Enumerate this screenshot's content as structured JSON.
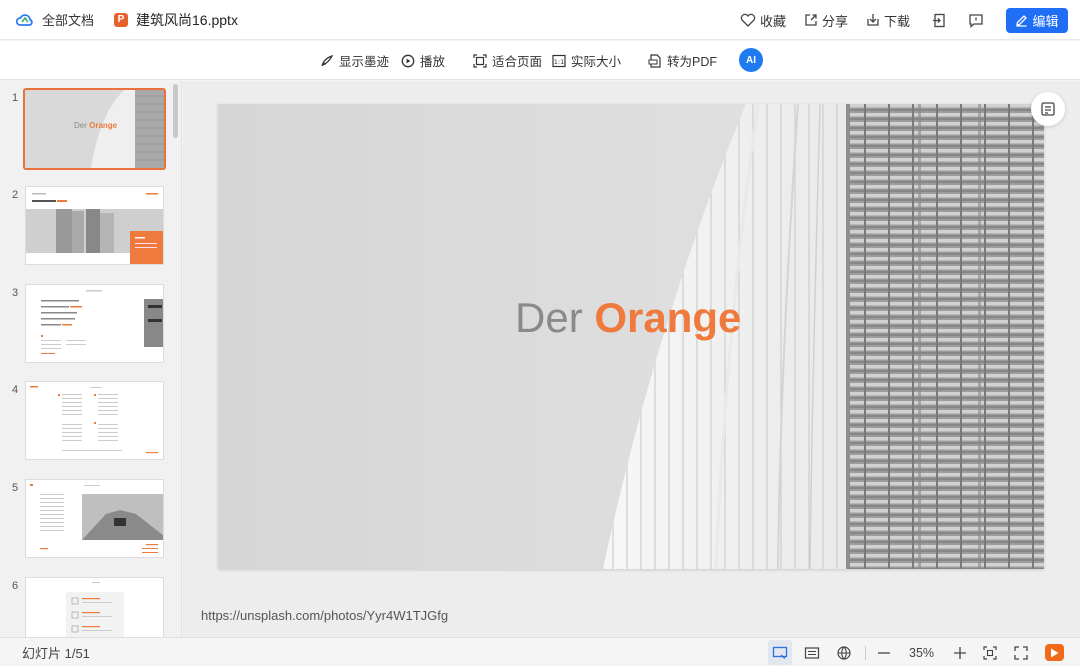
{
  "topbar": {
    "all_docs": "全部文档",
    "file_icon_letter": "P",
    "file_name": "建筑风尚16.pptx",
    "favorite": "收藏",
    "share": "分享",
    "download": "下载",
    "edit": "编辑"
  },
  "toolbar": {
    "show_ink": "显示墨迹",
    "play": "播放",
    "fit_page": "适合页面",
    "actual_size": "实际大小",
    "to_pdf": "转为PDF",
    "ai_label": "AI"
  },
  "thumbnails": [
    {
      "num": "1",
      "selected": true,
      "title_gray": "Der",
      "title_orange": "Orange"
    },
    {
      "num": "2",
      "selected": false
    },
    {
      "num": "3",
      "selected": false
    },
    {
      "num": "4",
      "selected": false
    },
    {
      "num": "5",
      "selected": false
    },
    {
      "num": "6",
      "selected": false
    }
  ],
  "slide": {
    "title_gray": "Der",
    "title_orange": "Orange"
  },
  "notes": "https://unsplash.com/photos/Yyr4W1TJGfg",
  "status": {
    "slide_counter": "幻灯片 1/51",
    "zoom": "35%"
  },
  "colors": {
    "accent": "#1f6ef5",
    "orange": "#ef7a3e",
    "selection": "#e8723a"
  }
}
